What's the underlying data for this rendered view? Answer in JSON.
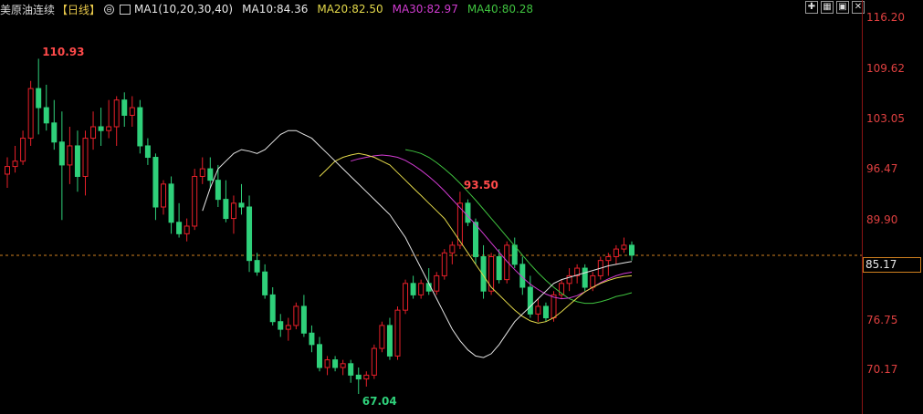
{
  "legend": {
    "title": "美原油连续",
    "period": "【日线】",
    "circle_icon": "⊖",
    "ma1": "MA1(10,20,30,40)",
    "ma10": "MA10:84.36",
    "ma20": "MA20:82.50",
    "ma30": "MA30:82.97",
    "ma40": "MA40:80.28"
  },
  "toolbar": [
    "fullscreen-icon",
    "grid-icon",
    "window-icon",
    "close-icon"
  ],
  "toolbar_glyphs": [
    "✚",
    "▦",
    "▣",
    "✕"
  ],
  "axis": {
    "ticks": [
      "116.20",
      "109.62",
      "103.05",
      "96.47",
      "89.90",
      "76.75",
      "70.17"
    ]
  },
  "current_price": "85.17",
  "colors": {
    "up": "#e8202a",
    "down": "#2fd07a",
    "ma10": "#e6e6e6",
    "ma20": "#e3d84a",
    "ma30": "#d13bd1",
    "ma40": "#3fc23f",
    "price_line": "#d08020"
  },
  "chart_data": {
    "type": "candlestick",
    "ylim": [
      67.04,
      116.2
    ],
    "annotations": {
      "high_1": "110.93",
      "high_2": "93.50",
      "low": "67.04"
    },
    "candles": [
      [
        95.8,
        98.0,
        94.0,
        96.8
      ],
      [
        96.8,
        99.5,
        96.0,
        97.5
      ],
      [
        97.5,
        101.5,
        97.0,
        100.5
      ],
      [
        100.5,
        108.0,
        99.5,
        107.0
      ],
      [
        107.0,
        110.9,
        101.0,
        104.5
      ],
      [
        104.5,
        107.5,
        101.5,
        102.5
      ],
      [
        102.5,
        105.5,
        99.0,
        100.0
      ],
      [
        100.0,
        104.0,
        89.8,
        97.0
      ],
      [
        97.0,
        102.0,
        94.5,
        99.5
      ],
      [
        99.5,
        101.5,
        93.5,
        95.5
      ],
      [
        95.5,
        101.5,
        93.0,
        100.5
      ],
      [
        100.5,
        104.0,
        99.0,
        102.0
      ],
      [
        102.0,
        104.5,
        99.5,
        101.5
      ],
      [
        101.5,
        105.5,
        100.5,
        102.0
      ],
      [
        102.0,
        106.0,
        99.5,
        105.5
      ],
      [
        105.5,
        106.5,
        102.0,
        103.5
      ],
      [
        103.5,
        106.0,
        102.0,
        104.5
      ],
      [
        104.5,
        105.5,
        98.5,
        99.5
      ],
      [
        99.5,
        100.5,
        97.0,
        98.0
      ],
      [
        98.0,
        98.5,
        89.8,
        91.5
      ],
      [
        91.5,
        95.0,
        90.5,
        94.5
      ],
      [
        94.5,
        95.5,
        88.0,
        89.5
      ],
      [
        89.5,
        92.0,
        87.5,
        88.0
      ],
      [
        88.0,
        90.0,
        87.0,
        89.0
      ],
      [
        89.0,
        96.5,
        88.5,
        95.5
      ],
      [
        95.5,
        98.0,
        94.5,
        96.5
      ],
      [
        96.5,
        98.0,
        94.0,
        95.0
      ],
      [
        95.0,
        97.0,
        91.5,
        92.5
      ],
      [
        92.5,
        95.0,
        89.5,
        90.0
      ],
      [
        90.0,
        93.0,
        88.0,
        92.0
      ],
      [
        92.0,
        94.5,
        90.5,
        91.5
      ],
      [
        91.5,
        93.0,
        83.0,
        84.5
      ],
      [
        84.5,
        85.5,
        82.5,
        83.0
      ],
      [
        83.0,
        84.0,
        79.5,
        80.0
      ],
      [
        80.0,
        81.0,
        76.0,
        76.5
      ],
      [
        76.5,
        77.5,
        74.5,
        75.5
      ],
      [
        75.5,
        77.0,
        74.0,
        76.0
      ],
      [
        76.0,
        79.0,
        75.5,
        78.5
      ],
      [
        78.5,
        80.0,
        74.5,
        75.0
      ],
      [
        75.0,
        76.0,
        72.5,
        73.5
      ],
      [
        73.5,
        74.5,
        70.0,
        70.5
      ],
      [
        70.5,
        72.0,
        69.5,
        71.5
      ],
      [
        71.5,
        72.0,
        70.0,
        70.5
      ],
      [
        70.5,
        71.5,
        69.5,
        71.0
      ],
      [
        71.0,
        71.5,
        68.5,
        69.5
      ],
      [
        69.5,
        70.5,
        67.04,
        69.0
      ],
      [
        69.0,
        70.0,
        68.0,
        69.5
      ],
      [
        69.5,
        73.5,
        69.0,
        73.0
      ],
      [
        73.0,
        76.5,
        72.5,
        76.0
      ],
      [
        76.0,
        77.0,
        71.5,
        72.0
      ],
      [
        72.0,
        78.5,
        71.5,
        78.0
      ],
      [
        78.0,
        82.0,
        77.5,
        81.5
      ],
      [
        81.5,
        82.5,
        79.5,
        80.0
      ],
      [
        80.0,
        82.0,
        79.5,
        81.5
      ],
      [
        81.5,
        83.5,
        80.0,
        80.5
      ],
      [
        80.5,
        83.0,
        80.0,
        82.5
      ],
      [
        82.5,
        86.0,
        82.0,
        85.5
      ],
      [
        85.5,
        87.0,
        84.0,
        86.5
      ],
      [
        86.5,
        93.5,
        86.0,
        92.0
      ],
      [
        92.0,
        92.5,
        89.0,
        89.5
      ],
      [
        89.5,
        90.0,
        84.0,
        85.0
      ],
      [
        85.0,
        86.5,
        79.5,
        80.5
      ],
      [
        80.5,
        85.5,
        80.0,
        85.0
      ],
      [
        85.0,
        86.0,
        81.5,
        82.0
      ],
      [
        82.0,
        87.0,
        81.5,
        86.5
      ],
      [
        86.5,
        87.5,
        83.5,
        84.0
      ],
      [
        84.0,
        85.0,
        80.0,
        81.0
      ],
      [
        81.0,
        82.5,
        77.0,
        77.5
      ],
      [
        77.5,
        79.5,
        76.5,
        78.5
      ],
      [
        78.5,
        79.0,
        76.5,
        77.0
      ],
      [
        77.0,
        80.5,
        76.5,
        80.0
      ],
      [
        80.0,
        82.0,
        79.5,
        81.5
      ],
      [
        81.5,
        83.5,
        80.5,
        82.5
      ],
      [
        82.5,
        84.0,
        81.5,
        83.5
      ],
      [
        83.5,
        84.0,
        80.5,
        81.0
      ],
      [
        81.0,
        83.0,
        80.5,
        82.5
      ],
      [
        82.5,
        85.0,
        82.0,
        84.5
      ],
      [
        84.5,
        85.5,
        82.5,
        85.0
      ],
      [
        85.0,
        86.5,
        84.0,
        86.0
      ],
      [
        86.0,
        87.5,
        85.5,
        86.5
      ],
      [
        86.5,
        87.0,
        84.5,
        85.2
      ]
    ],
    "ma10": [
      91.0,
      94.0,
      96.5,
      97.5,
      98.5,
      99.0,
      98.8,
      98.5,
      99.0,
      100.0,
      101.0,
      101.5,
      101.5,
      101.0,
      100.5,
      99.5,
      98.5,
      97.5,
      96.5,
      95.5,
      94.5,
      93.5,
      92.5,
      91.5,
      90.5,
      89.0,
      87.5,
      85.5,
      83.5,
      81.5,
      79.5,
      77.5,
      75.5,
      74.0,
      72.8,
      72.0,
      71.8,
      72.3,
      73.5,
      75.0,
      76.5,
      77.5,
      78.5,
      79.5,
      80.5,
      81.5,
      82.0,
      82.3,
      82.6,
      82.9,
      83.2,
      83.5,
      83.8,
      84.0,
      84.2,
      84.36
    ],
    "ma20": [
      95.5,
      96.5,
      97.5,
      98.0,
      98.3,
      98.5,
      98.3,
      98.0,
      97.5,
      97.0,
      96.0,
      95.0,
      94.0,
      93.0,
      92.0,
      91.0,
      90.0,
      88.5,
      87.0,
      85.5,
      84.0,
      82.5,
      81.0,
      80.0,
      79.0,
      78.0,
      77.2,
      76.6,
      76.3,
      76.5,
      77.0,
      77.8,
      78.7,
      79.6,
      80.4,
      81.0,
      81.5,
      81.9,
      82.2,
      82.4,
      82.5
    ],
    "ma30": [
      97.5,
      97.8,
      98.0,
      98.2,
      98.3,
      98.2,
      98.0,
      97.6,
      97.0,
      96.3,
      95.5,
      94.6,
      93.6,
      92.5,
      91.4,
      90.3,
      89.2,
      88.0,
      86.8,
      85.6,
      84.4,
      83.3,
      82.3,
      81.4,
      80.7,
      80.1,
      79.7,
      79.5,
      79.6,
      79.9,
      80.4,
      81.0,
      81.6,
      82.1,
      82.5,
      82.8,
      82.97
    ],
    "ma40": [
      99.0,
      98.8,
      98.5,
      98.0,
      97.3,
      96.5,
      95.6,
      94.6,
      93.5,
      92.4,
      91.2,
      90.0,
      88.8,
      87.6,
      86.4,
      85.2,
      84.0,
      82.9,
      81.9,
      81.0,
      80.2,
      79.5,
      79.1,
      78.9,
      78.9,
      79.1,
      79.4,
      79.8,
      80.0,
      80.28
    ]
  }
}
